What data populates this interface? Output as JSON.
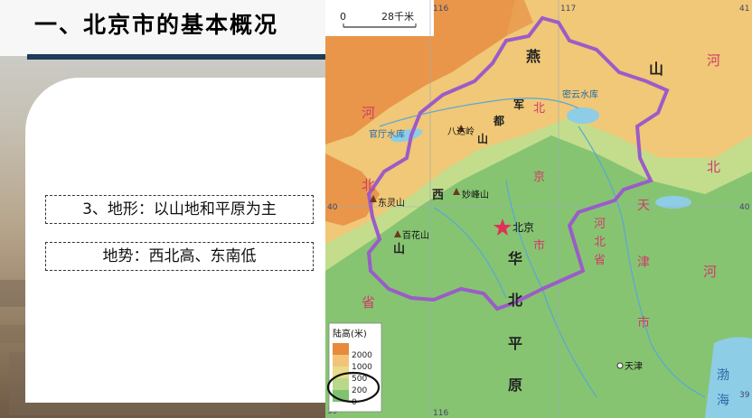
{
  "slide": {
    "title": "一、北京市的基本概况",
    "line1": "3、地形：以山地和平原为主",
    "line2": "地势：西北高、东南低"
  },
  "map": {
    "scale_zero": "0",
    "scale_distance": "28千米",
    "grid_labels": {
      "lon_116_top": "116",
      "lon_117_top": "117",
      "lon_116_bottom": "116",
      "lat_40_left": "40",
      "lat_39_left": "39",
      "lat_41_right": "41",
      "lat_40_right": "40",
      "lat_39_right": "39"
    },
    "mountain_chars": [
      "燕",
      "山",
      "军",
      "都",
      "山",
      "西",
      "山"
    ],
    "region_chars": {
      "hebei_left": [
        "河",
        "北",
        "省"
      ],
      "hebei_right": [
        "河",
        "北"
      ],
      "beijing_city": [
        "北",
        "京",
        "市"
      ],
      "tianjin_city": [
        "天",
        "津",
        "市"
      ],
      "hebei_south": [
        "河",
        "北",
        "省"
      ],
      "plain": [
        "华",
        "北",
        "平",
        "原"
      ],
      "bay": [
        "渤",
        "海"
      ]
    },
    "places": {
      "beijing": "北京",
      "tianjin": "天津",
      "badaling": "八达岭",
      "miaofengshan": "妙峰山",
      "dongling": "东灵山",
      "baihuashan": "百花山",
      "guanting": "官厅水库",
      "miyun": "密云水库"
    },
    "legend": {
      "title": "陆高(米)",
      "levels": [
        "2000",
        "1000",
        "500",
        "200",
        "0"
      ],
      "colors": [
        "#e88a3c",
        "#f4c37a",
        "#eadb8a",
        "#b9d98a",
        "#7fc26f"
      ]
    },
    "colors": {
      "boundary": "#9b5cc8",
      "water": "#8ecde6",
      "plain": "#86c472",
      "hill": "#c4dd8c",
      "mountain": "#f0c877",
      "high": "#e9964a"
    }
  }
}
